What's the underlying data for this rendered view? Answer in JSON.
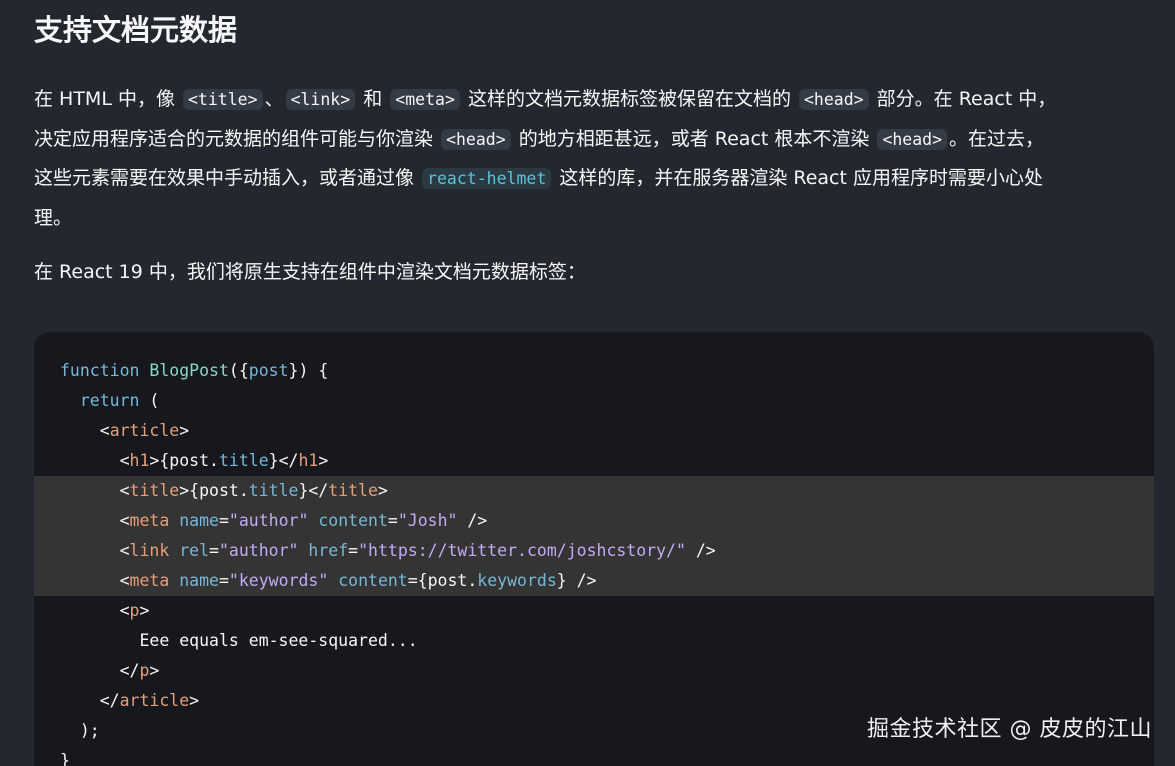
{
  "heading": "支持文档元数据",
  "paragraph1": {
    "l1_a": "在 HTML 中，像",
    "l1_c1": "<title>",
    "l1_b": "、",
    "l1_c2": "<link>",
    "l1_c": "和",
    "l1_c3": "<meta>",
    "l1_d": "这样的文档元数据标签被保留在文档的",
    "l1_c4": "<head>",
    "l1_e": "部分。在 React 中，",
    "l2_a": "决定应用程序适合的元数据的组件可能与你渲染",
    "l2_c1": "<head>",
    "l2_b": "的地方相距甚远，或者 React 根本不渲染",
    "l2_c2": "<head>",
    "l2_c": "。在过去，",
    "l3_a": "这些元素需要在效果中手动插入，或者通过像",
    "l3_c1": "react-helmet",
    "l3_b": "这样的库，并在服务器渲染 React 应用程序时需要小心处",
    "l4_a": "理。"
  },
  "paragraph2": "在 React 19 中，我们将原生支持在组件中渲染文档元数据标签：",
  "code": {
    "l1_kw": "function",
    "l1_fn": "BlogPost",
    "l1_p1": "({",
    "l1_arg": "post",
    "l1_p2": "}) {",
    "l2_kw": "return",
    "l2_p": " (",
    "l3_o": "<",
    "l3_tag": "article",
    "l3_c": ">",
    "l4_o": "<",
    "l4_tag": "h1",
    "l4_m1": ">{post.",
    "l4_prop": "title",
    "l4_m2": "}</",
    "l4_tag2": "h1",
    "l4_c": ">",
    "l5_o": "<",
    "l5_tag": "title",
    "l5_m1": ">{post.",
    "l5_prop": "title",
    "l5_m2": "}</",
    "l5_tag2": "title",
    "l5_c": ">",
    "l6_o": "<",
    "l6_tag": "meta",
    "l6_a1": "name",
    "l6_eq1": "=",
    "l6_s1": "\"author\"",
    "l6_a2": "content",
    "l6_eq2": "=",
    "l6_s2": "\"Josh\"",
    "l6_c": " />",
    "l7_o": "<",
    "l7_tag": "link",
    "l7_a1": "rel",
    "l7_eq1": "=",
    "l7_s1": "\"author\"",
    "l7_a2": "href",
    "l7_eq2": "=",
    "l7_s2": "\"https://twitter.com/joshcstory/\"",
    "l7_c": " />",
    "l8_o": "<",
    "l8_tag": "meta",
    "l8_a1": "name",
    "l8_eq1": "=",
    "l8_s1": "\"keywords\"",
    "l8_a2": "content",
    "l8_m": "={post.",
    "l8_prop": "keywords",
    "l8_c": "} />",
    "l9_o": "<",
    "l9_tag": "p",
    "l9_c": ">",
    "l10_text": "Eee equals em-see-squared...",
    "l11_o": "</",
    "l11_tag": "p",
    "l11_c": ">",
    "l12_o": "</",
    "l12_tag": "article",
    "l12_c": ">",
    "l13_text": ");",
    "l14_text": "}"
  },
  "watermark": "掘金技术社区 @ 皮皮的江山"
}
